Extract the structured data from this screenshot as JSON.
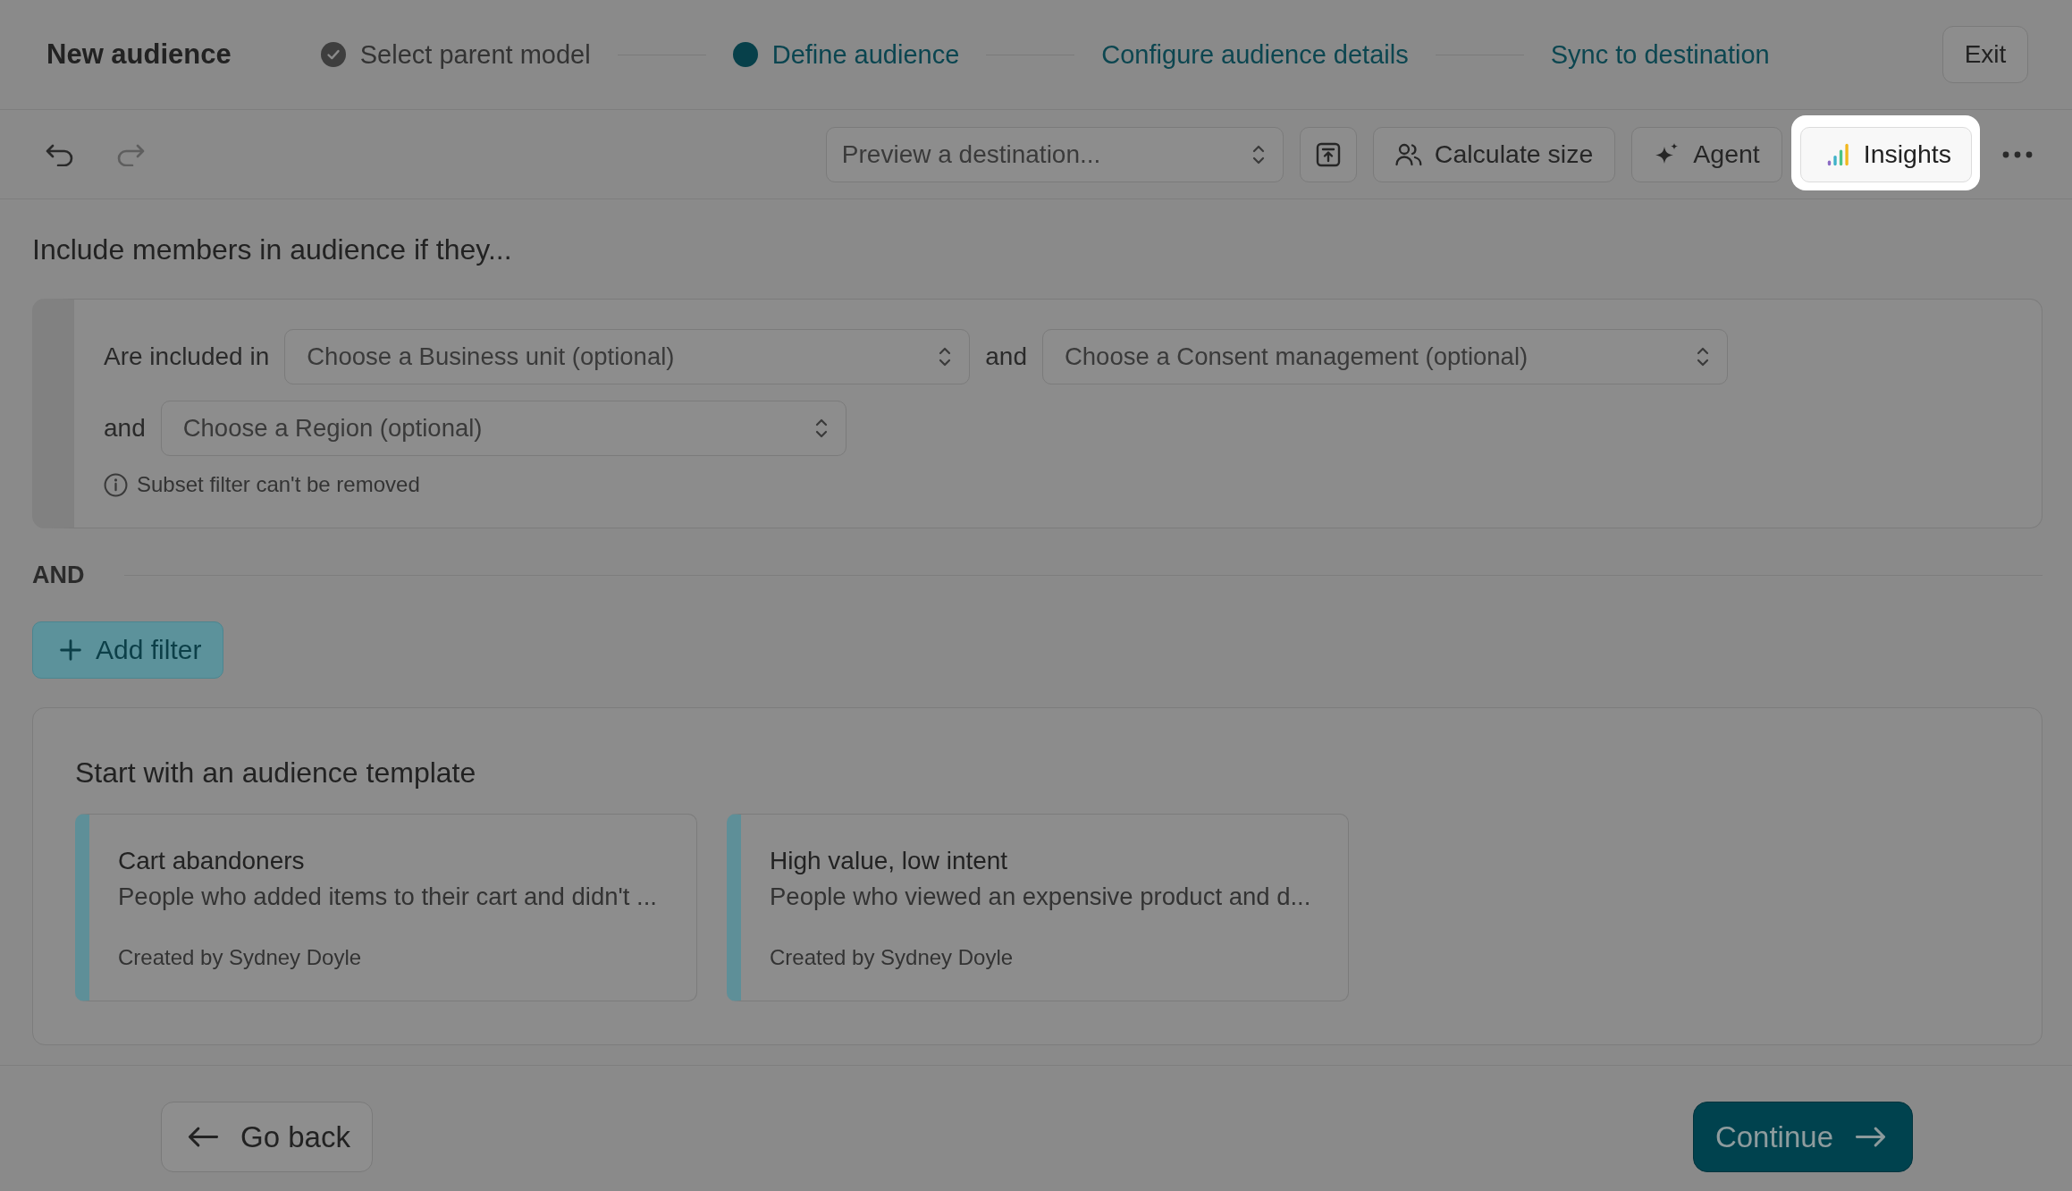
{
  "header": {
    "title": "New audience",
    "steps": [
      {
        "label": "Select parent model",
        "completed": true,
        "selected": false
      },
      {
        "label": "Define audience",
        "completed": false,
        "selected": true
      },
      {
        "label": "Configure audience details",
        "completed": false,
        "selected": false
      },
      {
        "label": "Sync to destination",
        "completed": false,
        "selected": false
      }
    ],
    "exit_button": "Exit"
  },
  "toolbar": {
    "history": [
      {
        "kind": "undo",
        "disabled": false
      },
      {
        "kind": "redo",
        "disabled": true
      }
    ],
    "destination_select": {
      "placeholder": "Preview a destination..."
    },
    "buttons": [
      {
        "kind": "size",
        "label": "Calculate size",
        "highlighted": false
      },
      {
        "kind": "agent",
        "label": "Agent",
        "highlighted": false
      },
      {
        "kind": "insights",
        "label": "Insights",
        "highlighted": true
      }
    ]
  },
  "filter": {
    "title": "Include members in audience if they...",
    "subset": {
      "conditions": [
        {
          "label": "Are included in",
          "placeholder": "Choose a Business unit (optional)"
        },
        {
          "label": "and",
          "placeholder": "Choose a Consent management (optional)"
        },
        {
          "label": "and",
          "placeholder": "Choose a Region (optional)"
        }
      ],
      "note": "Subset filter can't be removed"
    },
    "operator": "AND",
    "add_button": "Add filter"
  },
  "templates": {
    "title": "Start with an audience template",
    "items": [
      {
        "name": "Cart abandoners",
        "description": "People who added items to their cart and didn't ...",
        "author": "Created by Sydney Doyle"
      },
      {
        "name": "High value, low intent",
        "description": "People who viewed an expensive product and d...",
        "author": "Created by Sydney Doyle"
      }
    ]
  },
  "footer": {
    "back_button": "Go back",
    "continue_button": "Continue"
  }
}
